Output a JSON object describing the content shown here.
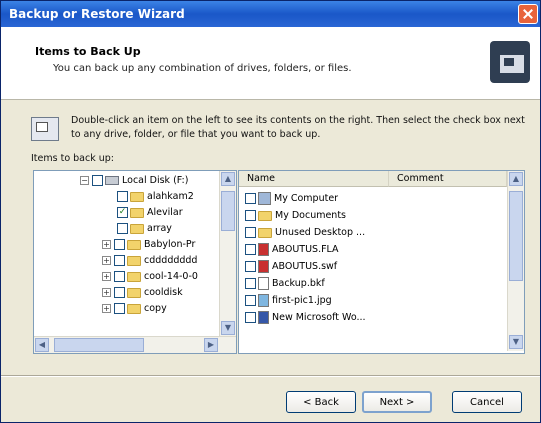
{
  "window": {
    "title": "Backup or Restore Wizard"
  },
  "header": {
    "title": "Items to Back Up",
    "subtitle": "You can back up any combination of drives, folders, or files."
  },
  "info": {
    "text": "Double-click an item on the left to see its contents on the right. Then select the check box next to any drive, folder, or file that you want to back up."
  },
  "tree": {
    "label": "Items to back up:",
    "items": [
      {
        "label": "Local Disk (F:)",
        "icon": "drive-icon",
        "expander": "-",
        "checked": false
      },
      {
        "label": "alahkam2",
        "icon": "folder-icon",
        "expander": "",
        "checked": false
      },
      {
        "label": "Alevilar",
        "icon": "folder-icon",
        "expander": "",
        "checked": true
      },
      {
        "label": "array",
        "icon": "folder-icon",
        "expander": "",
        "checked": false
      },
      {
        "label": "Babylon-Pr",
        "icon": "folder-icon",
        "expander": "+",
        "checked": false
      },
      {
        "label": "cdddddddd",
        "icon": "folder-icon",
        "expander": "+",
        "checked": false
      },
      {
        "label": "cool-14-0-0",
        "icon": "folder-icon",
        "expander": "+",
        "checked": false
      },
      {
        "label": "cooldisk",
        "icon": "folder-icon",
        "expander": "+",
        "checked": false
      },
      {
        "label": "copy",
        "icon": "folder-icon",
        "expander": "+",
        "checked": false
      }
    ]
  },
  "list": {
    "columns": [
      "Name",
      "Comment"
    ],
    "items": [
      {
        "label": "My Computer",
        "icon": "computer-icon"
      },
      {
        "label": "My Documents",
        "icon": "folder-icon"
      },
      {
        "label": "Unused Desktop ...",
        "icon": "folder-icon"
      },
      {
        "label": "ABOUTUS.FLA",
        "icon": "fla-file-icon"
      },
      {
        "label": "ABOUTUS.swf",
        "icon": "swf-file-icon"
      },
      {
        "label": "Backup.bkf",
        "icon": "backup-file-icon"
      },
      {
        "label": "first-pic1.jpg",
        "icon": "image-file-icon"
      },
      {
        "label": "New Microsoft Wo...",
        "icon": "word-file-icon"
      }
    ]
  },
  "buttons": {
    "back": "< Back",
    "next": "Next >",
    "cancel": "Cancel"
  }
}
